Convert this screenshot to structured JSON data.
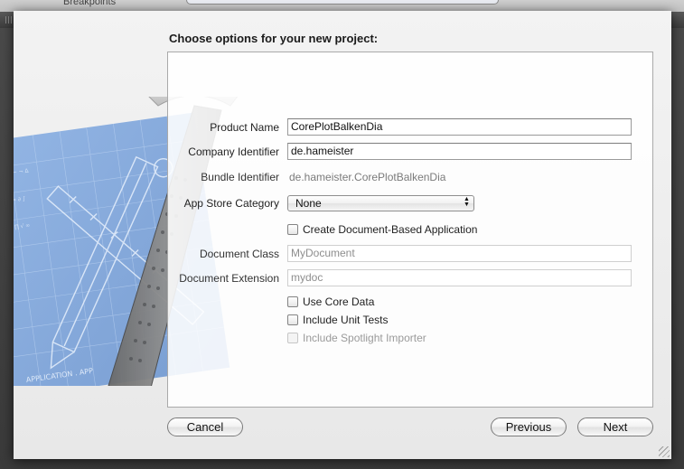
{
  "background": {
    "toolbar_label": "Breakpoints"
  },
  "sheet": {
    "title": "Choose options for your new project:"
  },
  "form": {
    "product_name": {
      "label": "Product Name",
      "value": "CorePlotBalkenDia"
    },
    "company_identifier": {
      "label": "Company Identifier",
      "value": "de.hameister"
    },
    "bundle_identifier": {
      "label": "Bundle Identifier",
      "value": "de.hameister.CorePlotBalkenDia"
    },
    "app_store_category": {
      "label": "App Store Category",
      "selected": "None"
    },
    "document_based": {
      "label": "Create Document-Based Application",
      "checked": false
    },
    "document_class": {
      "label": "Document Class",
      "placeholder": "MyDocument"
    },
    "document_extension": {
      "label": "Document Extension",
      "placeholder": "mydoc"
    },
    "use_core_data": {
      "label": "Use Core Data",
      "checked": false
    },
    "include_unit_tests": {
      "label": "Include Unit Tests",
      "checked": false
    },
    "include_spotlight_importer": {
      "label": "Include Spotlight Importer",
      "checked": false,
      "enabled": false
    }
  },
  "buttons": {
    "cancel": "Cancel",
    "previous": "Previous",
    "next": "Next"
  },
  "illustration": {
    "blueprint_caption": "APPLICATION . APP"
  },
  "colors": {
    "blueprint": "#6f9bd8",
    "sheet_bg": "#ececec"
  }
}
